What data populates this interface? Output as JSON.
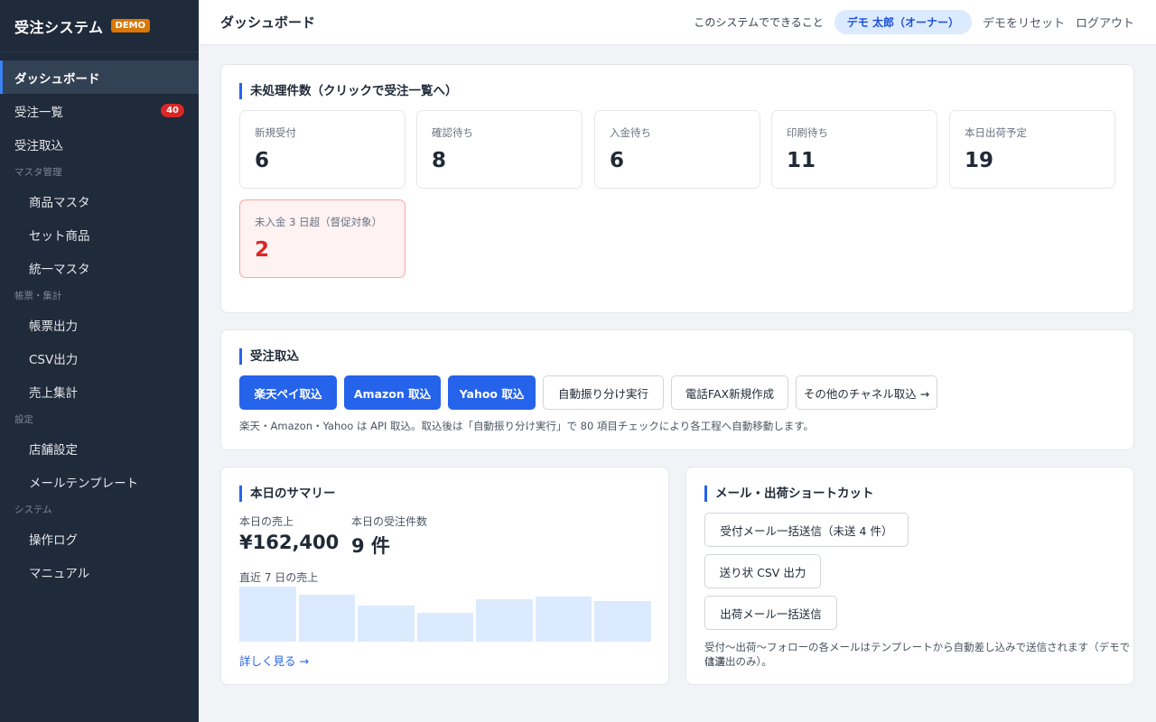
{
  "brand": {
    "title": "受注システム",
    "badge": "DEMO"
  },
  "sidebar": {
    "items": [
      {
        "label": "ダッシュボード"
      },
      {
        "label": "受注一覧",
        "badge": "40"
      },
      {
        "label": "受注取込"
      }
    ],
    "sections": [
      {
        "title": "マスタ管理",
        "items": [
          "商品マスタ",
          "セット商品",
          "統一マスタ"
        ]
      },
      {
        "title": "帳票・集計",
        "items": [
          "帳票出力",
          "CSV出力",
          "売上集計"
        ]
      },
      {
        "title": "設定",
        "items": [
          "店舗設定",
          "メールテンプレート"
        ]
      },
      {
        "title": "システム",
        "items": [
          "操作ログ",
          "マニュアル"
        ]
      }
    ]
  },
  "header": {
    "title": "ダッシュボード",
    "help_link": "このシステムでできること",
    "user": "デモ 太郎（オーナー）",
    "reset": "デモをリセット",
    "logout": "ログアウト"
  },
  "pending": {
    "title": "未処理件数（クリックで受注一覧へ）",
    "stats": [
      {
        "label": "新規受付",
        "value": "6"
      },
      {
        "label": "確認待ち",
        "value": "8"
      },
      {
        "label": "入金待ち",
        "value": "6"
      },
      {
        "label": "印刷待ち",
        "value": "11"
      },
      {
        "label": "本日出荷予定",
        "value": "19"
      }
    ],
    "alert": {
      "label": "未入金 3 日超（督促対象）",
      "value": "2"
    }
  },
  "import": {
    "title": "受注取込",
    "buttons": [
      "楽天ペイ取込",
      "Amazon 取込",
      "Yahoo 取込",
      "自動振り分け実行",
      "電話FAX新規作成",
      "その他のチャネル取込 →"
    ],
    "note": "楽天・Amazon・Yahoo は API 取込。取込後は「自動振り分け実行」で 80 項目チェックにより各工程へ自動移動します。"
  },
  "summary": {
    "title": "本日のサマリー",
    "sales_label": "本日の売上",
    "sales_value": "¥162,400",
    "orders_label": "本日の受注件数",
    "orders_value": "9 件",
    "chart_label": "直近 7 日の売上",
    "chart_values": [
      100,
      85,
      65,
      53,
      77,
      82,
      73
    ],
    "more_link": "詳しく見る →"
  },
  "shortcuts": {
    "title": "メール・出荷ショートカット",
    "buttons": [
      "受付メール一括送信（未送 4 件）",
      "送り状 CSV 出力",
      "出荷メール一括送信"
    ],
    "note_line1": "受付〜出荷〜フォローの各メールはテンプレートから自動差し込みで送信されます（デモでは送",
    "note_line2": "信演出のみ）。"
  },
  "colors": {
    "accent": "#2563eb",
    "sidebar": "#1f2a3a",
    "alert": "#dc2626",
    "brand_badge": "#d97706"
  }
}
